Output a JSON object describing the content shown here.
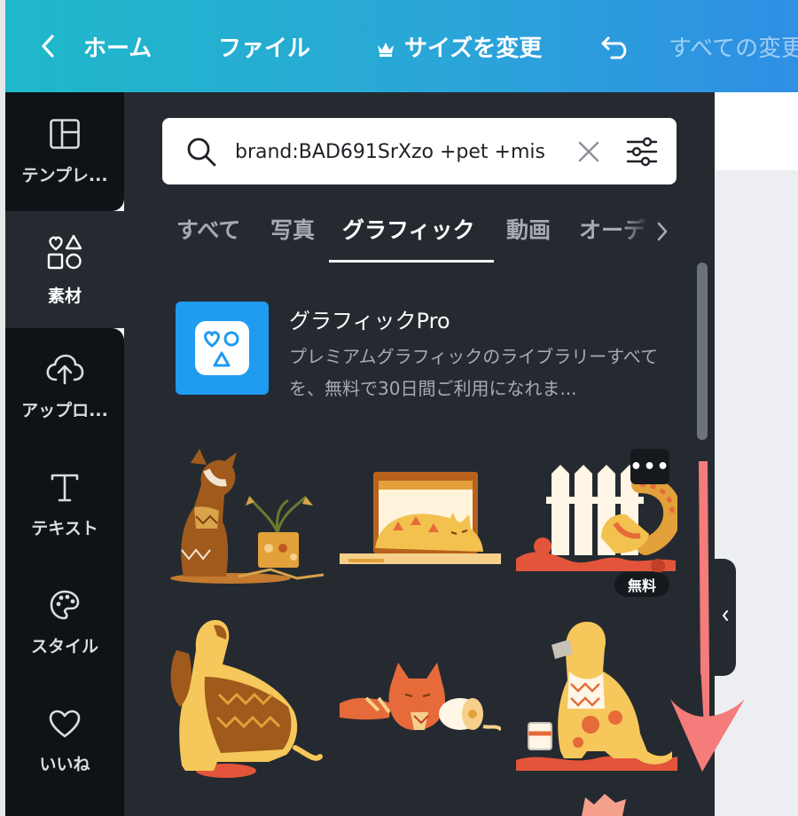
{
  "topbar": {
    "home_label": "ホーム",
    "file_label": "ファイル",
    "resize_label": "サイズを変更",
    "save_status": "すべての変更"
  },
  "rail": {
    "items": [
      {
        "label": "テンプレ...",
        "icon": "template-icon"
      },
      {
        "label": "素材",
        "icon": "elements-icon"
      },
      {
        "label": "アップロ...",
        "icon": "upload-icon"
      },
      {
        "label": "テキスト",
        "icon": "text-icon"
      },
      {
        "label": "スタイル",
        "icon": "palette-icon"
      },
      {
        "label": "いいね",
        "icon": "heart-icon"
      }
    ]
  },
  "search": {
    "value": "brand:BAD691SrXzo +pet +mis"
  },
  "tabs": {
    "items": [
      "すべて",
      "写真",
      "グラフィック",
      "動画",
      "オーデ"
    ],
    "active": "グラフィック"
  },
  "promo": {
    "title": "グラフィックPro",
    "description": "プレミアムグラフィックのライブラリーすべてを、無料で30日間ご利用になれま..."
  },
  "grid": {
    "items": [
      {
        "name": "dog-with-plant"
      },
      {
        "name": "cat-on-laptop"
      },
      {
        "name": "dog-at-fence",
        "badge": "無料",
        "more": "•••"
      },
      {
        "name": "spaniel-in-sweater"
      },
      {
        "name": "cat-with-toilet-paper"
      },
      {
        "name": "retriever-with-paint"
      }
    ]
  },
  "colors": {
    "accent_gradient_start": "#1fb8c9",
    "accent_gradient_end": "#2f8fe4",
    "panel_bg": "#252a31",
    "rail_bg": "#0e1318",
    "annotation_arrow": "#f47c7a"
  }
}
